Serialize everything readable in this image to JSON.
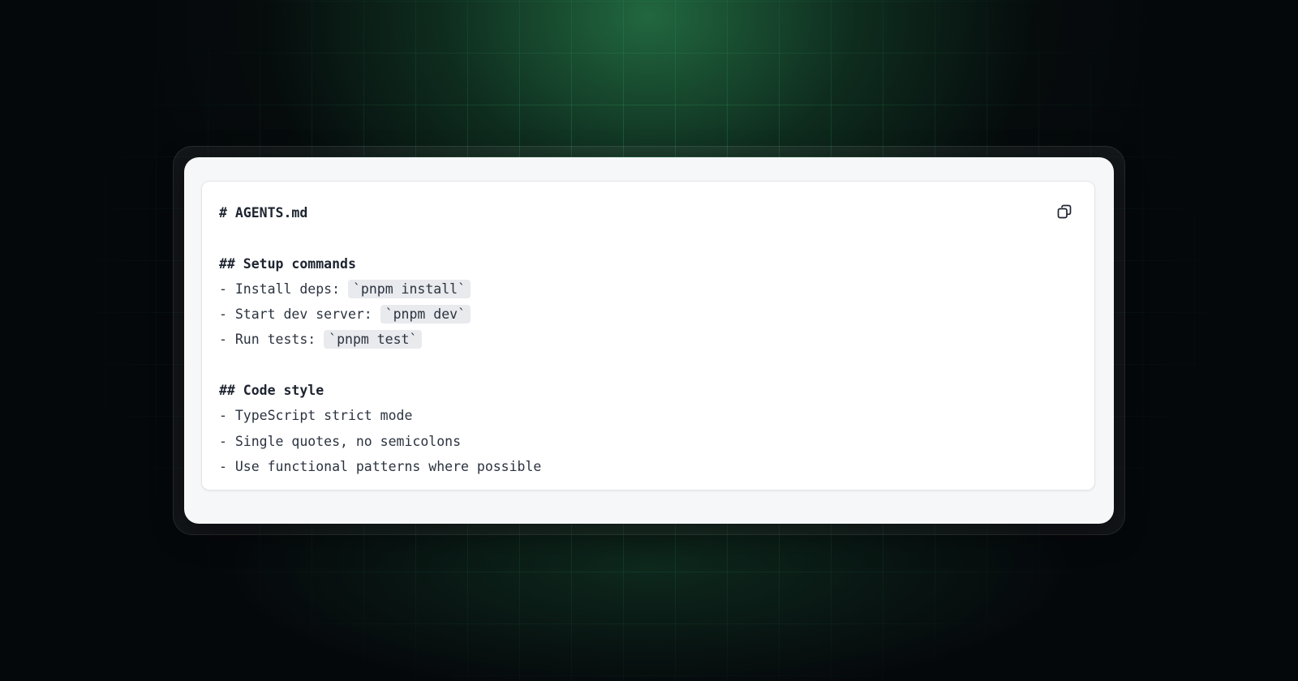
{
  "document": {
    "title_line": "# AGENTS.md",
    "setup": {
      "heading": "## Setup commands",
      "items": [
        {
          "prefix": "- Install deps: ",
          "code": "`pnpm install`"
        },
        {
          "prefix": "- Start dev server: ",
          "code": "`pnpm dev`"
        },
        {
          "prefix": "- Run tests: ",
          "code": "`pnpm test`"
        }
      ]
    },
    "style": {
      "heading": "## Code style",
      "items": [
        "- TypeScript strict mode",
        "- Single quotes, no semicolons",
        "- Use functional patterns where possible"
      ]
    }
  },
  "copy_button": {
    "icon": "copy-icon"
  },
  "colors": {
    "background": "#05080b",
    "grid_accent": "#3cc878",
    "card": "#f6f7f9",
    "panel": "#ffffff",
    "text": "#2b3340",
    "code_bg": "#e8eaed"
  }
}
